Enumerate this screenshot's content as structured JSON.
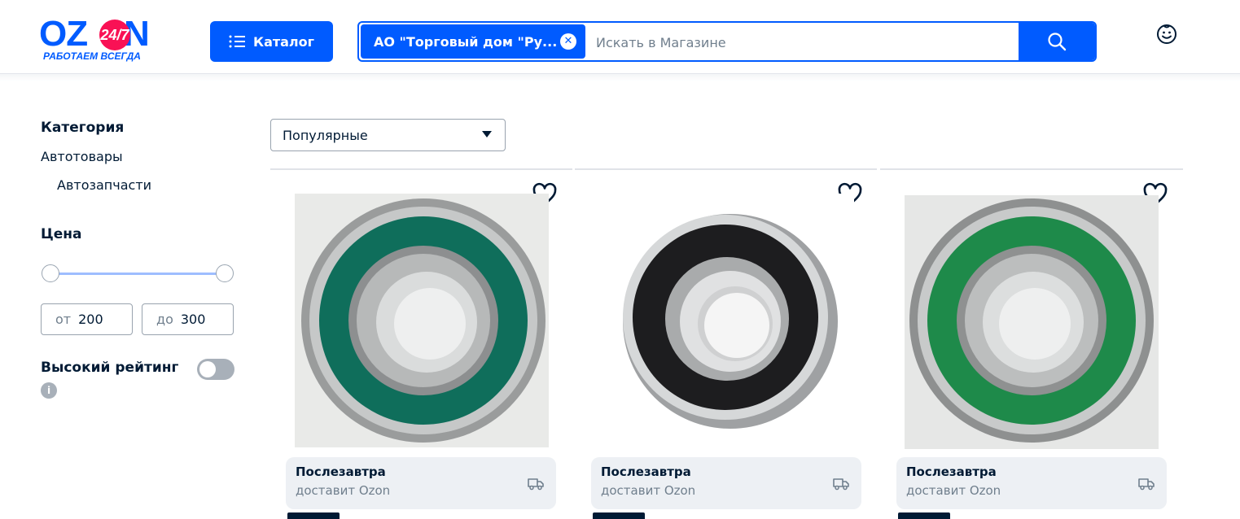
{
  "header": {
    "logo": {
      "word": "OZON",
      "badge": "24/7",
      "tagline": "РАБОТАЕМ ВСЕГДА"
    },
    "catalog_label": "Каталог",
    "search": {
      "chip_label": "АО \"Торговый дом \"Ру...",
      "placeholder": "Искать в Магазине",
      "value": ""
    }
  },
  "filters": {
    "category_title": "Категория",
    "category_items": [
      "Автотовары",
      "Автозапчасти"
    ],
    "price_title": "Цена",
    "price_from_prefix": "от",
    "price_from": "200",
    "price_to_prefix": "до",
    "price_to": "300",
    "price_range_fraction": [
      0,
      1
    ],
    "high_rating_label": "Высокий рейтинг",
    "high_rating_on": false,
    "info_glyph": "i"
  },
  "sort": {
    "selected": "Популярные"
  },
  "products": [
    {
      "image": "bearing-green-seal",
      "delivery_title": "Послезавтра",
      "delivery_subtitle": "доставит Ozon"
    },
    {
      "image": "bearing-black-seal",
      "delivery_title": "Послезавтра",
      "delivery_subtitle": "доставит Ozon"
    },
    {
      "image": "bearing-green-seal",
      "delivery_title": "Послезавтра",
      "delivery_subtitle": "доставит Ozon"
    }
  ],
  "colors": {
    "brand_blue": "#005bff",
    "brand_pink": "#f91155",
    "text_primary": "#001a34",
    "text_secondary": "#707f8d",
    "slider_track": "#9ebdff",
    "delivery_bg": "#edf0f4"
  },
  "icons": {
    "catalog": "list-icon",
    "chip_close": "close-circle-icon",
    "search": "search-icon",
    "profile": "smiley-icon",
    "favorite": "heart-icon",
    "delivery": "truck-icon",
    "sort": "caret-down-icon",
    "info": "info-icon"
  }
}
